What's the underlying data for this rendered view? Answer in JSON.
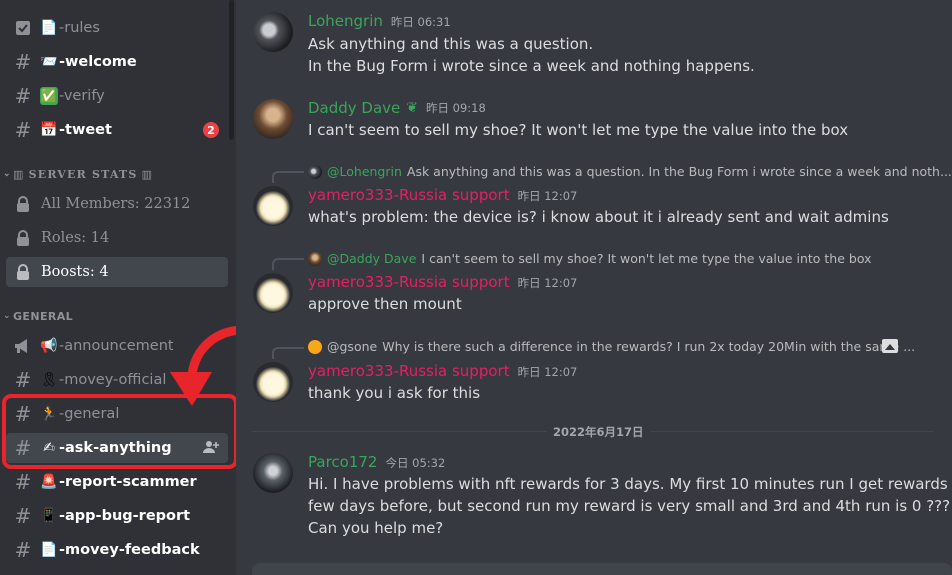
{
  "sidebar": {
    "channels_top": [
      {
        "icon": "checkbox-icon",
        "emoji": "📄",
        "name": "-rules",
        "bold": false
      },
      {
        "icon": "hash-icon",
        "emoji": "📨",
        "name": "-welcome",
        "bold": true
      },
      {
        "icon": "hash-icon",
        "emoji": "✅",
        "name": "-verify",
        "bold": false
      },
      {
        "icon": "hash-icon",
        "emoji": "📅",
        "name": "-tweet",
        "bold": true,
        "badge": "2"
      }
    ],
    "stats_category": "SERVER STATS",
    "stats_channels": [
      {
        "name": "All Members: 22312"
      },
      {
        "name": "Roles: 14"
      },
      {
        "name": "Boosts: 4"
      }
    ],
    "general_category": "GENERAL",
    "general_channels": [
      {
        "icon": "megaphone-icon",
        "emoji": "📢",
        "name": "-announcement"
      },
      {
        "icon": "hash-icon",
        "emoji": "🎗",
        "name": "-movey-official"
      },
      {
        "icon": "hash-icon",
        "emoji": "🏃",
        "name": "-general"
      },
      {
        "icon": "hash-icon",
        "emoji": "✍",
        "name": "-ask-anything"
      },
      {
        "icon": "hash-icon",
        "emoji": "🚨",
        "name": "-report-scammer"
      },
      {
        "icon": "hash-icon",
        "emoji": "📱",
        "name": "-app-bug-report"
      },
      {
        "icon": "hash-icon",
        "emoji": "📄",
        "name": "-movey-feedback"
      }
    ]
  },
  "messages": {
    "lohengrin": {
      "author": "Lohengrin",
      "time": "昨日 06:31",
      "lines": [
        "Ask anything and this was a question.",
        "In the Bug Form i wrote since a week and nothing happens."
      ]
    },
    "dave": {
      "author": "Daddy Dave",
      "time": "昨日 09:18",
      "lines": [
        "I can't seem to sell my shoe? It won't let me type the value into the box"
      ]
    },
    "reply1": {
      "ref_name": "@Lohengrin",
      "ref_text": "Ask anything and this was a question. In the Bug Form i wrote since a week and noth...",
      "author": "yamero333-Russia support",
      "time": "昨日 12:07",
      "text": "what's problem: the device is? i know about it i already sent and wait admins"
    },
    "reply2": {
      "ref_name": "@Daddy Dave",
      "ref_text": "I can't seem to sell my shoe? It won't let me type the value into the box",
      "author": "yamero333-Russia support",
      "time": "昨日 12:07",
      "text": "approve then mount"
    },
    "reply3": {
      "ref_name": "@gsone",
      "ref_text": "Why is there such a difference in the rewards? I run 2x today 20Min  with the same ...",
      "author": "yamero333-Russia support",
      "time": "昨日 12:07",
      "text": "thank you i ask for this"
    },
    "divider": "2022年6月17日",
    "parco": {
      "author": "Parco172",
      "time": "今日 05:32",
      "lines": [
        "Hi. I have problems with nft rewards for 3 days. My first 10 minutes run I get rewards as",
        "few days before, but second run my reward is very small and 3rd and 4th run is 0 ???",
        "Can you help me?"
      ]
    }
  },
  "colors": {
    "green_name": "#3ba55c",
    "support_name": "#e91e63",
    "highlight": "#e8252a"
  }
}
